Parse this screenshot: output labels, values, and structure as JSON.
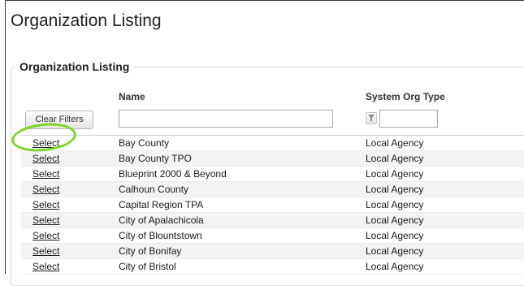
{
  "page": {
    "title": "Organization Listing"
  },
  "section": {
    "legend": "Organization Listing"
  },
  "grid": {
    "columns": {
      "name": "Name",
      "type": "System Org Type"
    },
    "clear_filters_label": "Clear Filters",
    "filters": {
      "name_value": "",
      "type_value": ""
    },
    "select_label": "Select",
    "rows": [
      {
        "name": "Bay County",
        "type": "Local Agency"
      },
      {
        "name": "Bay County TPO",
        "type": "Local Agency"
      },
      {
        "name": "Blueprint 2000 & Beyond",
        "type": "Local Agency"
      },
      {
        "name": "Calhoun County",
        "type": "Local Agency"
      },
      {
        "name": "Capital Region TPA",
        "type": "Local Agency"
      },
      {
        "name": "City of Apalachicola",
        "type": "Local Agency"
      },
      {
        "name": "City of Blountstown",
        "type": "Local Agency"
      },
      {
        "name": "City of Bonifay",
        "type": "Local Agency"
      },
      {
        "name": "City of Bristol",
        "type": "Local Agency"
      }
    ]
  },
  "icons": {
    "filter": "funnel-filter-icon"
  },
  "colors": {
    "highlight": "#7dd623",
    "alt_row": "#f3f3f3"
  }
}
